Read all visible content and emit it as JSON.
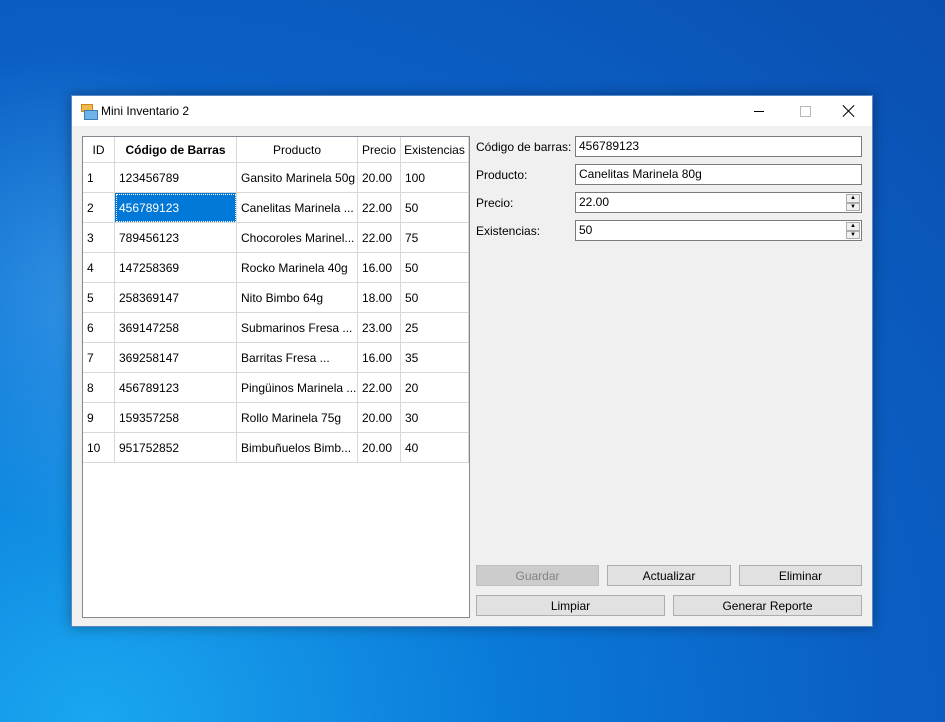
{
  "window": {
    "title": "Mini Inventario 2"
  },
  "grid": {
    "headers": [
      "ID",
      "Código de Barras",
      "Producto",
      "Precio",
      "Existencias"
    ],
    "rows": [
      [
        "1",
        "123456789",
        "Gansito Marinela 50g",
        "20.00",
        "100"
      ],
      [
        "2",
        "456789123",
        "Canelitas Marinela ...",
        "22.00",
        "50"
      ],
      [
        "3",
        "789456123",
        "Chocoroles Marinel...",
        "22.00",
        "75"
      ],
      [
        "4",
        "147258369",
        "Rocko Marinela 40g",
        "16.00",
        "50"
      ],
      [
        "5",
        "258369147",
        "Nito Bimbo 64g",
        "18.00",
        "50"
      ],
      [
        "6",
        "369147258",
        "Submarinos Fresa ...",
        "23.00",
        "25"
      ],
      [
        "7",
        "369258147",
        "Barritas Fresa ...",
        "16.00",
        "35"
      ],
      [
        "8",
        "456789123",
        "Pingüinos Marinela ...",
        "22.00",
        "20"
      ],
      [
        "9",
        "159357258",
        "Rollo Marinela 75g",
        "20.00",
        "30"
      ],
      [
        "10",
        "951752852",
        "Bimbuñuelos Bimb...",
        "20.00",
        "40"
      ]
    ]
  },
  "form": {
    "barcode_label": "Código de barras:",
    "barcode_value": "456789123",
    "product_label": "Producto:",
    "product_value": "Canelitas Marinela 80g",
    "price_label": "Precio:",
    "price_value": "22.00",
    "stock_label": "Existencias:",
    "stock_value": "50"
  },
  "buttons": {
    "save": "Guardar",
    "update": "Actualizar",
    "delete": "Eliminar",
    "clear": "Limpiar",
    "report": "Generar Reporte"
  },
  "colors": {
    "selection": "#0078d7",
    "desktop": "#0a79d8"
  }
}
